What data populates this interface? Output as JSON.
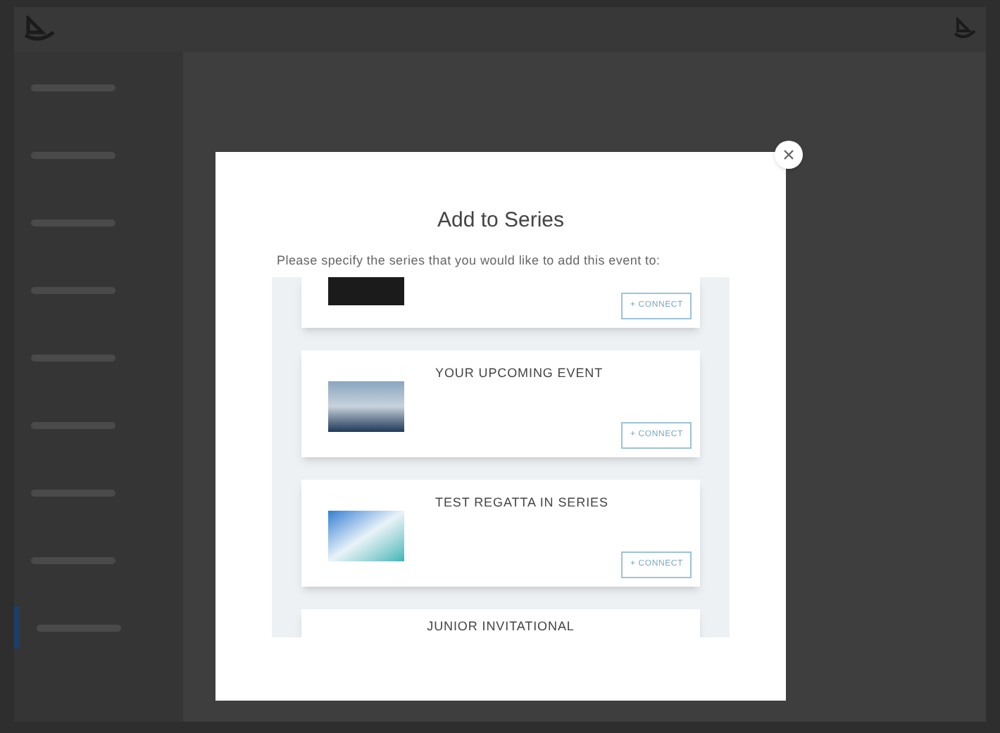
{
  "dialog": {
    "title": "Add to Series",
    "description": "Please specify the series that you would like to add this event to:",
    "series": [
      {
        "kind": "dark",
        "button": "+ CONNECT"
      },
      {
        "name": "YOUR UPCOMING EVENT",
        "kind": "photo",
        "button": "+ CONNECT"
      },
      {
        "name": "TEST REGATTA IN SERIES",
        "kind": "graphic",
        "button": "+ CONNECT"
      },
      {
        "name": "JUNIOR INVITATIONAL",
        "kind": "text"
      }
    ]
  },
  "sidebar": {
    "items": [
      {
        "selected": false
      },
      {
        "selected": false
      },
      {
        "selected": false
      },
      {
        "selected": false
      },
      {
        "selected": false
      },
      {
        "selected": false
      },
      {
        "selected": false
      },
      {
        "selected": false
      },
      {
        "selected": true
      }
    ]
  }
}
